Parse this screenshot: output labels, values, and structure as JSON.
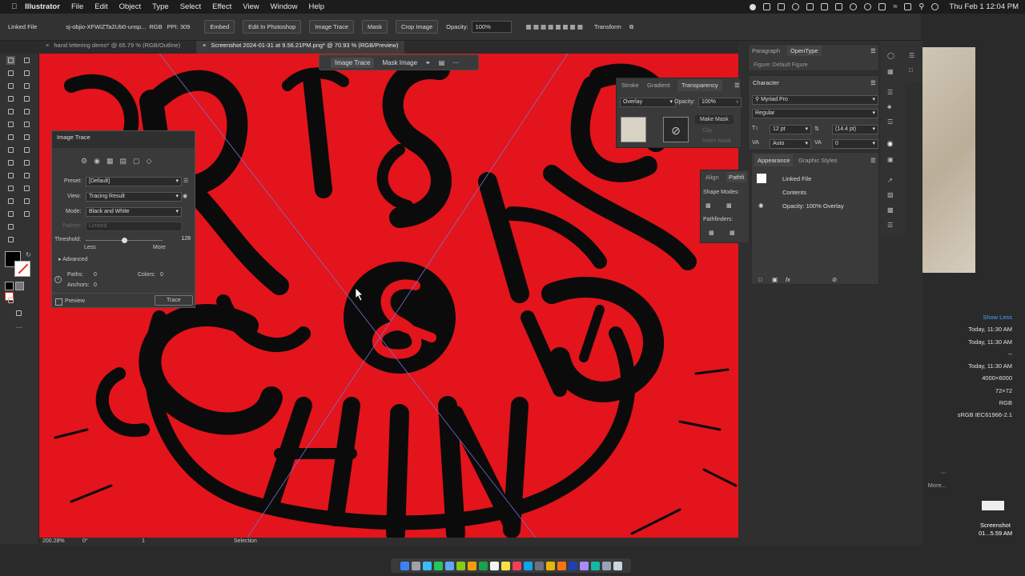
{
  "menubar": {
    "app": "Illustrator",
    "items": [
      "File",
      "Edit",
      "Object",
      "Type",
      "Select",
      "Effect",
      "View",
      "Window",
      "Help"
    ],
    "clock": "Thu Feb 1  12:04 PM"
  },
  "control_bar": {
    "linked_file": "Linked File",
    "filename": "sj-objio-XFWiZTa2Ub0-unsp...",
    "color_mode": "RGB",
    "ppi": "PPI: 309",
    "embed": "Embed",
    "edit_photoshop": "Edit In Photoshop",
    "image_trace": "Image Trace",
    "mask": "Mask",
    "crop_image": "Crop Image",
    "opacity_label": "Opacity:",
    "opacity_value": "100%",
    "transform": "Transform"
  },
  "tabs": [
    {
      "label": "hand lettering demo* @ 65.79 % (RGB/Outline)"
    },
    {
      "label": "Screenshot 2024-01-31 at 9.56.21PM.png* @ 70.93 % (RGB/Preview)"
    }
  ],
  "floatbar": {
    "image_trace": "Image Trace",
    "mask_image": "Mask Image"
  },
  "image_trace_panel": {
    "title": "Image Trace",
    "preset_label": "Preset:",
    "preset_value": "[Default]",
    "view_label": "View:",
    "view_value": "Tracing Result",
    "mode_label": "Mode:",
    "mode_value": "Black and White",
    "palette_label": "Palette:",
    "palette_value": "Limited",
    "threshold_label": "Threshold:",
    "threshold_value": "128",
    "threshold_fraction": 0.5,
    "less": "Less",
    "more": "More",
    "advanced": "Advanced",
    "paths_label": "Paths:",
    "paths_value": "0",
    "colors_label": "Colors:",
    "colors_value": "0",
    "anchors_label": "Anchors:",
    "anchors_value": "0",
    "preview": "Preview",
    "trace": "Trace"
  },
  "transparency_panel": {
    "tabs": [
      "Stroke",
      "Gradient",
      "Transparency"
    ],
    "blend": "Overlay",
    "opacity_label": "Opacity:",
    "opacity_value": "100%",
    "make_mask": "Make Mask",
    "clip": "Clip",
    "invert_mask": "Invert Mask"
  },
  "paragraph_panel": {
    "tabs": [
      "Paragraph",
      "OpenType"
    ],
    "figure": "Figure:  Default Figure"
  },
  "character_panel": {
    "title": "Character",
    "font": "Myriad Pro",
    "style": "Regular",
    "size": "12 pt",
    "leading": "(14.4 pt)",
    "kerning": "Auto",
    "tracking": "0"
  },
  "align_panel": {
    "tabs": [
      "Align",
      "Pathfi"
    ],
    "shape_modes": "Shape Modes:",
    "pathfinders": "Pathfinders:"
  },
  "appearance_panel": {
    "tabs": [
      "Appearance",
      "Graphic Styles"
    ],
    "linked_file": "Linked File",
    "contents": "Contents",
    "opacity": "Opacity: 100% Overlay"
  },
  "finder_info": {
    "show_less": "Show Less",
    "rows": [
      "Today, 11:30 AM",
      "Today, 11:30 AM",
      "--",
      "Today, 11:30 AM",
      "4000×6000",
      "72×72",
      "RGB",
      "sRGB IEC61966-2.1"
    ],
    "more": "More...",
    "screenshot_label": "Screenshot",
    "screenshot_time": "01...5.59 AM"
  },
  "status": {
    "zoom": "200.28%",
    "rotation": "0°",
    "artboard": "1",
    "mode": "Selection"
  },
  "colors": {
    "canvas": "#e3141b",
    "ink": "#0b0b0b"
  }
}
